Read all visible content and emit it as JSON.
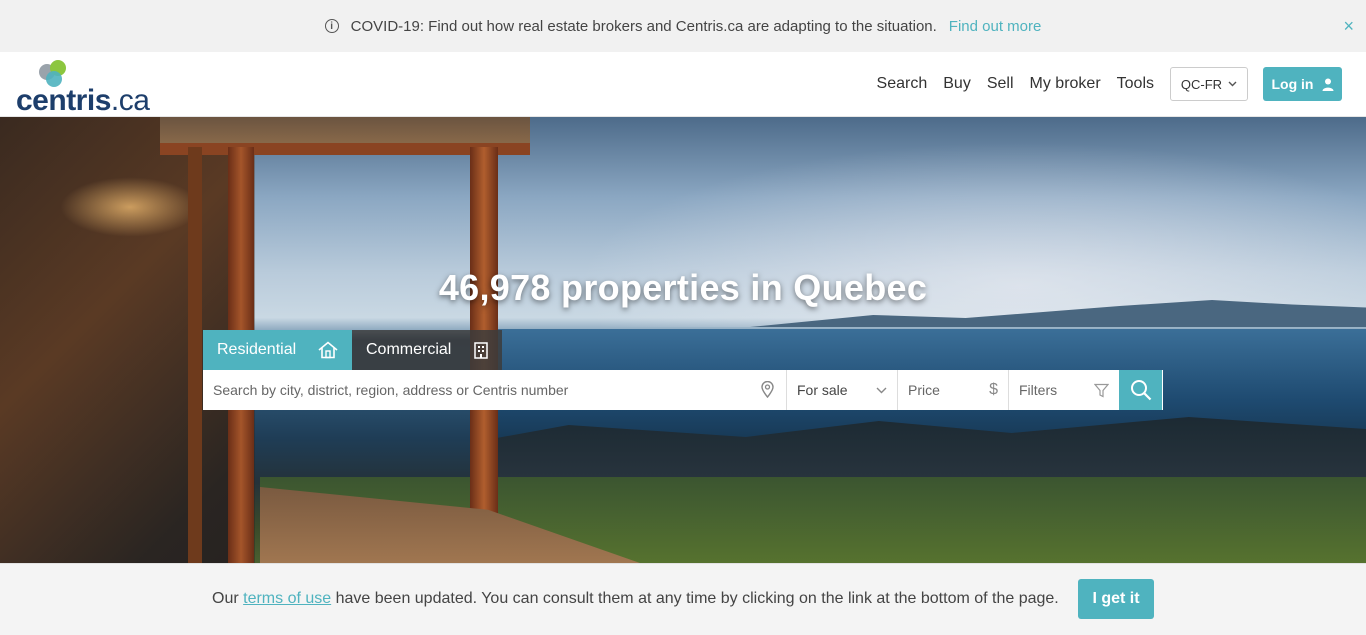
{
  "banner": {
    "message": "COVID-19: Find out how real estate brokers and Centris.ca are adapting to the situation.",
    "link": "Find out more",
    "close": "×",
    "info_icon": "i"
  },
  "header": {
    "logo_main": "centris",
    "logo_ext": ".ca",
    "nav": [
      "Search",
      "Buy",
      "Sell",
      "My broker",
      "Tools"
    ],
    "lang": "QC-FR",
    "login": "Log in"
  },
  "hero": {
    "title": "46,978 properties in Quebec",
    "tabs": {
      "residential": "Residential",
      "commercial": "Commercial"
    },
    "search": {
      "placeholder": "Search by city, district, region, address or Centris number",
      "for_sale": "For sale",
      "price": "Price",
      "price_symbol": "$",
      "filters": "Filters"
    }
  },
  "terms": {
    "before": "Our ",
    "link": "terms of use",
    "after": " have been updated. You can consult them at any time by clicking on the link at the bottom of the page.",
    "button": "I get it"
  },
  "colors": {
    "accent": "#4fb3bf",
    "logo": "#1d3e6b"
  }
}
